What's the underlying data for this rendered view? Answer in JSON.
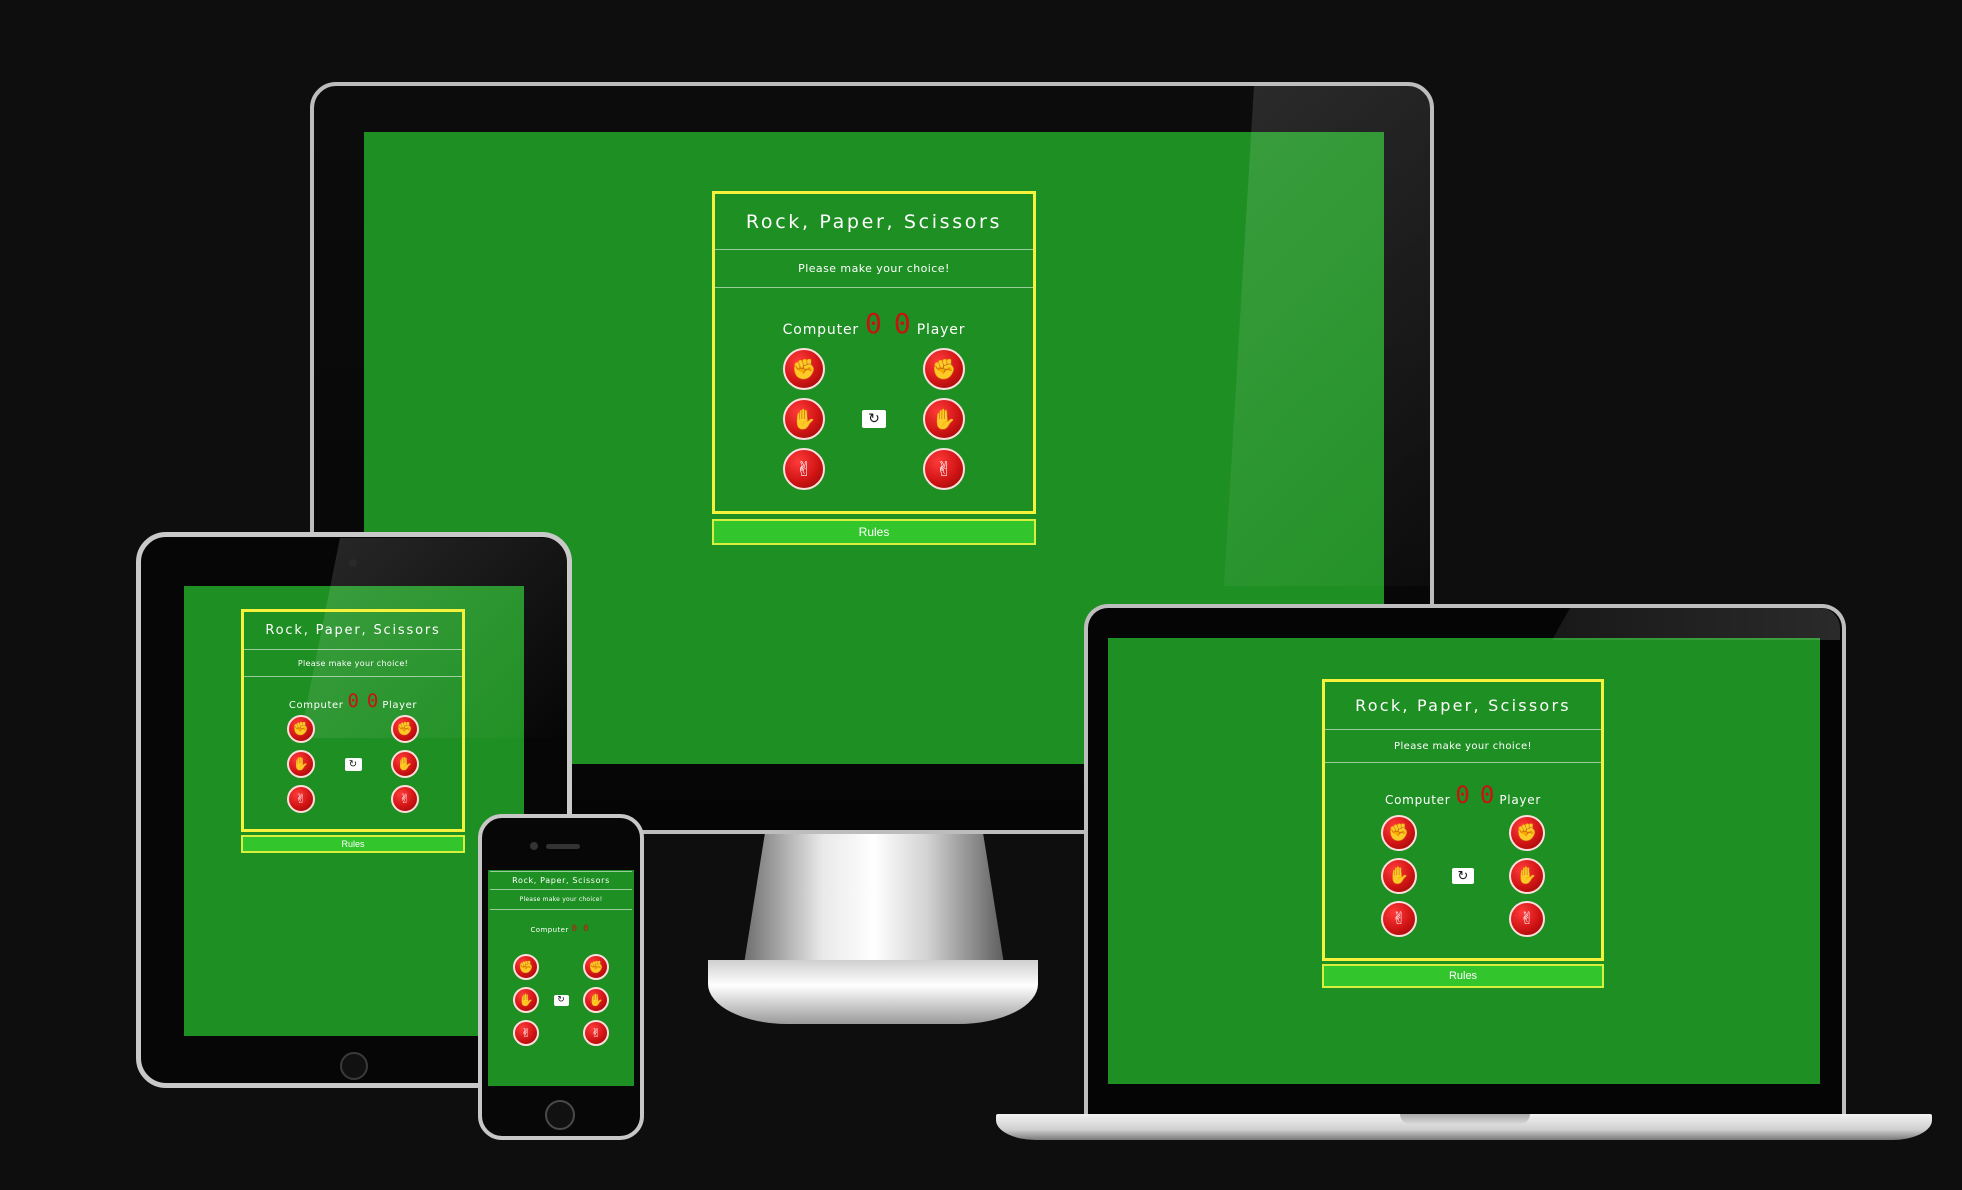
{
  "game": {
    "title": "Rock, Paper, Scissors",
    "message": "Please make your choice!",
    "computer_label": "Computer",
    "player_label": "Player",
    "computer_score": "0",
    "player_score": "0",
    "reset_icon": "↻",
    "rules_label": "Rules",
    "computer_choices": [
      {
        "name": "rock",
        "icon": "✊"
      },
      {
        "name": "paper",
        "icon": "✋"
      },
      {
        "name": "scissors",
        "icon": "✌"
      }
    ],
    "player_choices": [
      {
        "name": "rock",
        "icon": "✊"
      },
      {
        "name": "paper",
        "icon": "✋"
      },
      {
        "name": "scissors",
        "icon": "✌"
      }
    ]
  },
  "colors": {
    "page_background": "#0e0e0f",
    "game_background": "#1e8f22",
    "card_border": "#f4f23a",
    "score_color": "#c81212",
    "hand_button": "#d11414",
    "rules_button": "#33c52c"
  },
  "devices": [
    "desktop",
    "laptop",
    "tablet",
    "phone"
  ]
}
